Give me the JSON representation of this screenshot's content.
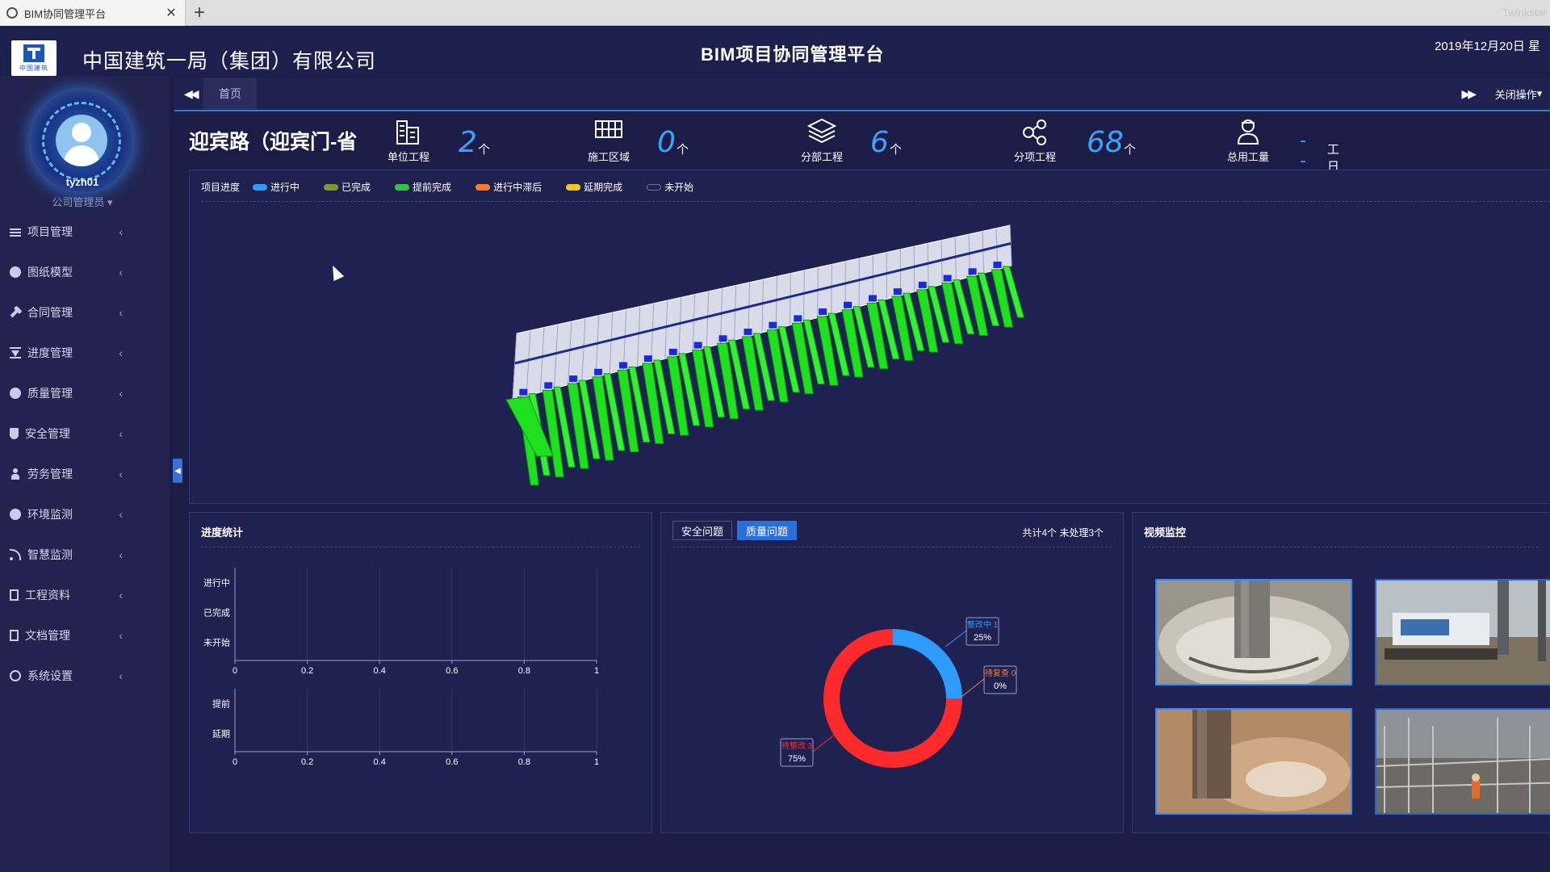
{
  "browser": {
    "tab_title": "BIM协同管理平台",
    "brand": "Twinkstar"
  },
  "header": {
    "logo_caption": "中国建筑",
    "company_name": "中国建筑一局（集团）有限公司",
    "platform_title": "BIM项目协同管理平台",
    "date": "2019年12月20日 星"
  },
  "user": {
    "name": "tyzh01",
    "role": "公司管理员"
  },
  "sidebar": {
    "items": [
      {
        "label": "项目管理",
        "icon": "list-icon"
      },
      {
        "label": "图纸模型",
        "icon": "cube-icon"
      },
      {
        "label": "合同管理",
        "icon": "wrench-icon"
      },
      {
        "label": "进度管理",
        "icon": "hourglass-icon"
      },
      {
        "label": "质量管理",
        "icon": "gear-icon"
      },
      {
        "label": "安全管理",
        "icon": "shield-icon"
      },
      {
        "label": "劳务管理",
        "icon": "worker-icon"
      },
      {
        "label": "环境监测",
        "icon": "globe-icon"
      },
      {
        "label": "智慧监测",
        "icon": "rss-icon"
      },
      {
        "label": "工程资料",
        "icon": "file-icon"
      },
      {
        "label": "文档管理",
        "icon": "document-icon"
      },
      {
        "label": "系统设置",
        "icon": "power-icon"
      }
    ]
  },
  "tabs": {
    "home": "首页",
    "close_ops": "关闭操作"
  },
  "project": {
    "name": "迎宾路（迎宾门-省"
  },
  "stats": [
    {
      "label": "单位工程",
      "value": "2",
      "unit": "个",
      "icon": "building-icon"
    },
    {
      "label": "施工区域",
      "value": "0",
      "unit": "个",
      "icon": "fence-icon"
    },
    {
      "label": "分部工程",
      "value": "6",
      "unit": "个",
      "icon": "layers-icon"
    },
    {
      "label": "分项工程",
      "value": "68",
      "unit": "个",
      "icon": "share-nodes-icon"
    },
    {
      "label": "总用工量",
      "value": "--",
      "unit": "工日",
      "icon": "worker-icon"
    }
  ],
  "legend": {
    "title": "项目进度",
    "items": [
      {
        "label": "进行中",
        "color": "#2f9bff"
      },
      {
        "label": "已完成",
        "color": "#7a9a2a"
      },
      {
        "label": "提前完成",
        "color": "#2fc24a"
      },
      {
        "label": "进行中滞后",
        "color": "#ff7a2a"
      },
      {
        "label": "延期完成",
        "color": "#f2c81e"
      },
      {
        "label": "未开始",
        "color": "#3a3f6a"
      }
    ]
  },
  "progress_panel": {
    "title": "进度统计"
  },
  "chart_data": [
    {
      "type": "bar",
      "orientation": "horizontal",
      "categories": [
        "进行中",
        "已完成",
        "未开始"
      ],
      "values": [
        0,
        0,
        0
      ],
      "xlim": [
        0,
        1
      ],
      "xticks": [
        "0",
        "0.2",
        "0.4",
        "0.6",
        "0.8",
        "1"
      ],
      "grid": true
    },
    {
      "type": "bar",
      "orientation": "horizontal",
      "categories": [
        "提前",
        "延期"
      ],
      "values": [
        0,
        0
      ],
      "xlim": [
        0,
        1
      ],
      "xticks": [
        "0",
        "0.2",
        "0.4",
        "0.6",
        "0.8",
        "1"
      ],
      "grid": true
    },
    {
      "type": "pie",
      "style": "donut",
      "slices": [
        {
          "label": "整改中 1",
          "value": 25,
          "percent": "25%",
          "color": "#2f9bff"
        },
        {
          "label": "待复查 0",
          "value": 0,
          "percent": "0%",
          "color": "#ff7a2a"
        },
        {
          "label": "待整改 3",
          "value": 75,
          "percent": "75%",
          "color": "#ff2a2a"
        }
      ]
    }
  ],
  "issues_panel": {
    "tab_safety": "安全问题",
    "tab_quality": "质量问题",
    "summary": "共计4个 未处理3个"
  },
  "video_panel": {
    "title": "视频监控"
  }
}
